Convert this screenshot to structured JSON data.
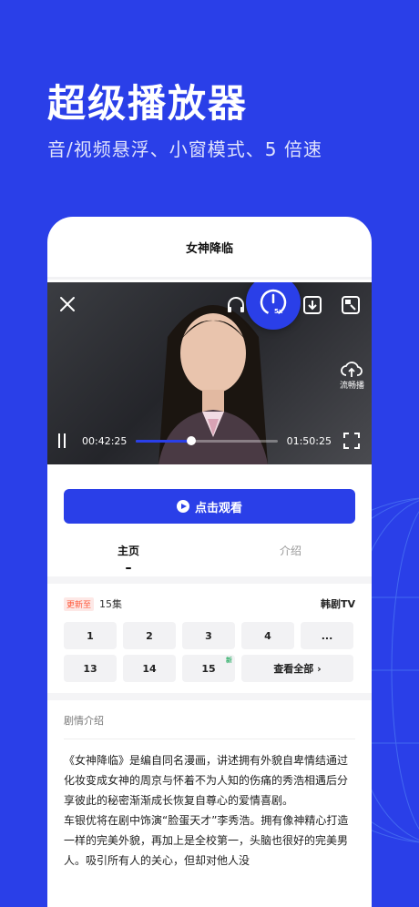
{
  "promo": {
    "headline": "超级播放器",
    "subline": "音/视频悬浮、小窗模式、5 倍速"
  },
  "app": {
    "title": "女神降临"
  },
  "player": {
    "speed_label": "5x",
    "smooth_label": "流畅播",
    "current_time": "00:42:25",
    "total_time": "01:50:25",
    "progress": 0.39
  },
  "actions": {
    "watch_label": "点击观看"
  },
  "tabs": [
    {
      "label": "主页",
      "active": true
    },
    {
      "label": "介绍",
      "active": false
    }
  ],
  "episodes": {
    "badge": "更新至",
    "count": "15集",
    "source": "韩剧TV",
    "items": [
      "1",
      "2",
      "3",
      "4",
      "...",
      "13",
      "14",
      "15"
    ],
    "new_tag": "新",
    "view_all": "查看全部 ›"
  },
  "intro": {
    "title": "剧情介绍",
    "p1": "《女神降临》是编自同名漫画，讲述拥有外貌自卑情结通过化妆变成女神的周京与怀着不为人知的伤痛的秀浩相遇后分享彼此的秘密渐渐成长恢复自尊心的爱情喜剧。",
    "p2": "车银优将在剧中饰演“脸蛋天才”李秀浩。拥有像神精心打造一样的完美外貌，再加上是全校第一，头脑也很好的完美男人。吸引所有人的关心，但却对他人没"
  },
  "colors": {
    "brand": "#2a3fe8",
    "new_badge": "#ff5a3c",
    "new_tag": "#3cb371"
  }
}
